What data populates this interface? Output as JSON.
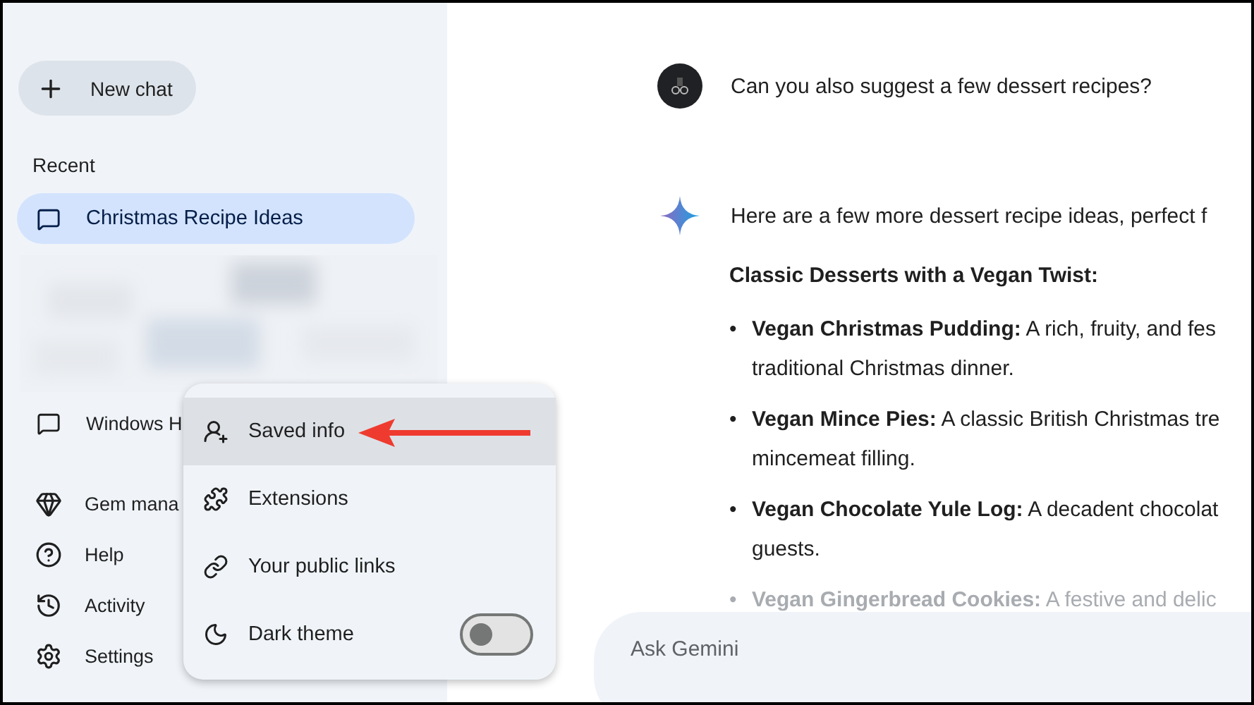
{
  "sidebar": {
    "new_chat": "New chat",
    "recent_label": "Recent",
    "recent": [
      {
        "label": "Christmas Recipe Ideas",
        "selected": true
      },
      {
        "label": "Windows H",
        "selected": false
      }
    ],
    "bottom": [
      {
        "label": "Gem mana"
      },
      {
        "label": "Help"
      },
      {
        "label": "Activity"
      },
      {
        "label": "Settings"
      }
    ]
  },
  "menu": {
    "items": [
      {
        "label": "Saved info",
        "kind": "item",
        "selected": true
      },
      {
        "label": "Extensions",
        "kind": "item",
        "selected": false
      },
      {
        "label": "Your public links",
        "kind": "item",
        "selected": false
      },
      {
        "label": "Dark theme",
        "kind": "toggle",
        "selected": false,
        "on": false
      }
    ]
  },
  "chat": {
    "user_message": "Can you also suggest a few dessert recipes?",
    "intro": "Here are a few more dessert recipe ideas, perfect f",
    "heading": "Classic Desserts with a Vegan Twist:",
    "bullets": [
      {
        "marker": "•",
        "title": "Vegan Christmas Pudding:",
        "text": "A rich, fruity, and fes",
        "continuation": "traditional Christmas dinner.",
        "faded": false
      },
      {
        "marker": "•",
        "title": "Vegan Mince Pies:",
        "text": "A classic British Christmas tre",
        "continuation": "mincemeat filling.",
        "faded": false
      },
      {
        "marker": "•",
        "title": "Vegan Chocolate Yule Log:",
        "text": "A decadent chocolat",
        "continuation": "guests.",
        "faded": false
      },
      {
        "marker": "•",
        "title": "Vegan Gingerbread Cookies:",
        "text": "A festive and delic",
        "faded": true
      }
    ]
  },
  "input": {
    "placeholder": "Ask Gemini"
  }
}
